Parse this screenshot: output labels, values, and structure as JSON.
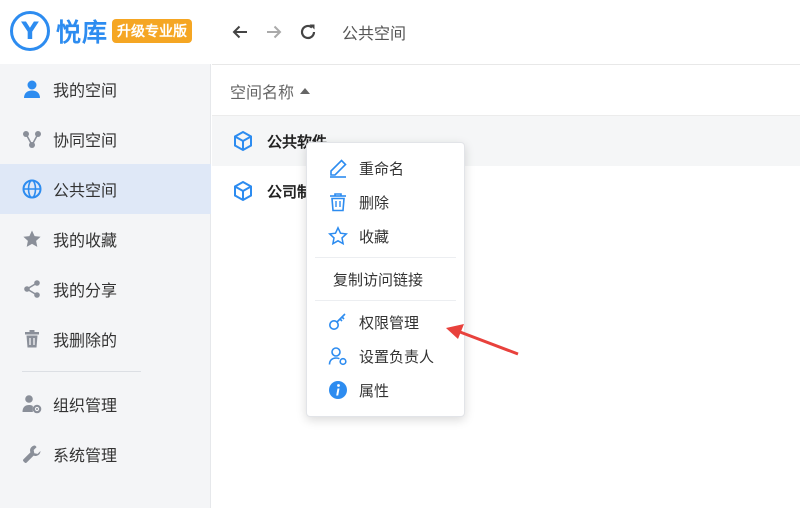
{
  "app": {
    "logo_mark": "Y",
    "logo_text": "悦库",
    "upgrade_badge": "升级专业版"
  },
  "sidebar": {
    "items": [
      {
        "label": "我的空间",
        "icon": "user-icon"
      },
      {
        "label": "协同空间",
        "icon": "collab-icon"
      },
      {
        "label": "公共空间",
        "icon": "globe-icon",
        "active": true
      },
      {
        "label": "我的收藏",
        "icon": "star-icon"
      },
      {
        "label": "我的分享",
        "icon": "share-icon"
      },
      {
        "label": "我删除的",
        "icon": "trash-icon"
      }
    ],
    "admin_items": [
      {
        "label": "组织管理",
        "icon": "org-user-gear-icon"
      },
      {
        "label": "系统管理",
        "icon": "wrench-icon"
      }
    ]
  },
  "toolbar": {
    "breadcrumb": "公共空间",
    "icons": [
      "back-arrow-icon",
      "forward-arrow-icon",
      "refresh-icon"
    ]
  },
  "list": {
    "column_header": "空间名称",
    "sort": "ascending",
    "rows": [
      {
        "name": "公共软件",
        "icon": "cube-icon"
      },
      {
        "name": "公司制",
        "icon": "cube-icon"
      }
    ]
  },
  "context_menu": {
    "items": [
      {
        "label": "重命名",
        "icon": "pencil-icon"
      },
      {
        "label": "删除",
        "icon": "trash-icon"
      },
      {
        "label": "收藏",
        "icon": "star-outline-icon"
      },
      {
        "label": "复制访问链接"
      },
      {
        "label": "权限管理",
        "icon": "key-icon"
      },
      {
        "label": "设置负责人",
        "icon": "user-setting-icon"
      },
      {
        "label": "属性",
        "icon": "info-icon"
      }
    ]
  },
  "colors": {
    "brand": "#2d8cf0",
    "badge": "#f5a623",
    "sidebar_bg": "#f4f5f7",
    "active_bg": "#dfe8f7",
    "annotation_arrow": "#e8413c"
  }
}
